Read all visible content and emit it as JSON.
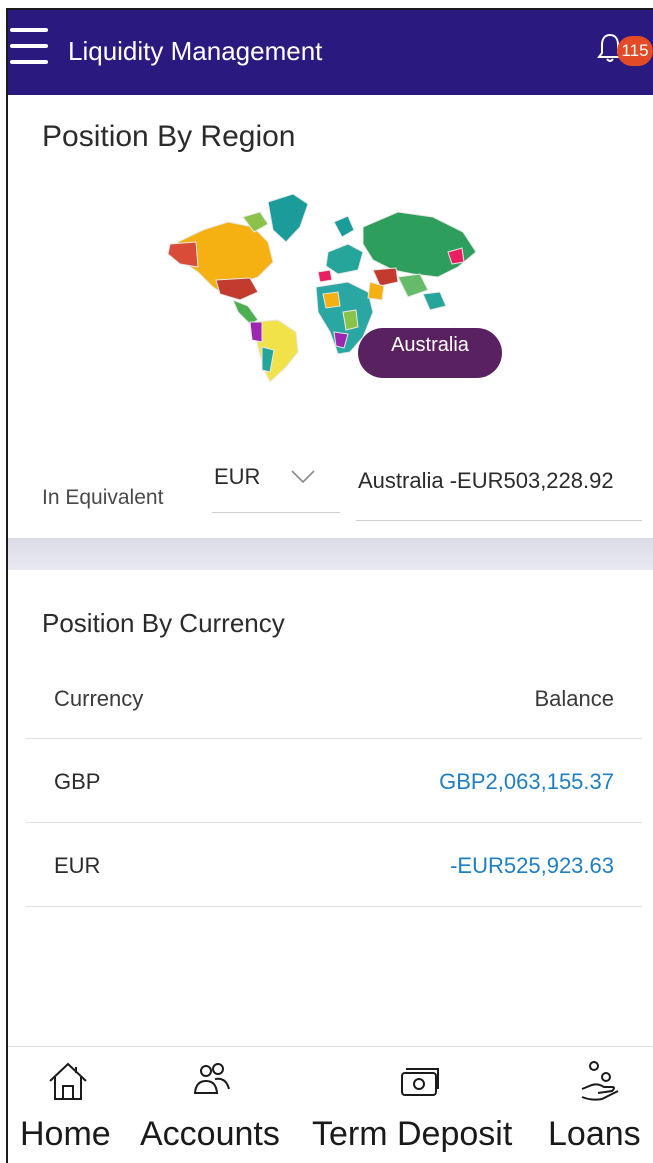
{
  "header": {
    "title": "Liquidity Management",
    "notification_count": "115"
  },
  "region_section": {
    "title": "Position By Region",
    "map_tooltip": "Australia",
    "equivalent_label": "In Equivalent",
    "currency_select_value": "EUR",
    "region_value": "Australia -EUR503,228.92"
  },
  "currency_section": {
    "title": "Position By Currency",
    "columns": [
      "Currency",
      "Balance"
    ],
    "rows": [
      {
        "currency": "GBP",
        "balance": "GBP2,063,155.37"
      },
      {
        "currency": "EUR",
        "balance": "-EUR525,923.63"
      }
    ]
  },
  "tabbar": {
    "tabs": [
      {
        "label": "Home",
        "icon": "home-icon"
      },
      {
        "label": "Accounts",
        "icon": "accounts-icon"
      },
      {
        "label": "Term Deposit",
        "icon": "term-deposit-icon"
      },
      {
        "label": "Loans",
        "icon": "loans-icon"
      }
    ]
  },
  "colors": {
    "header_bg": "#2a1a80",
    "badge": "#e34b26",
    "tooltip": "#5a2160",
    "link": "#1f7fc4"
  }
}
